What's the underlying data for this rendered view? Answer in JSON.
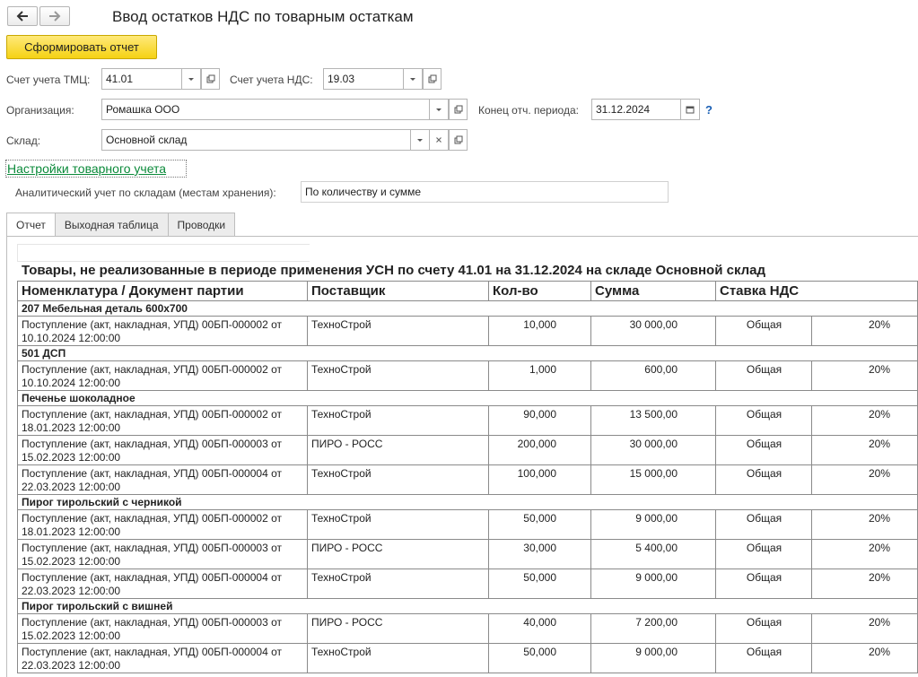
{
  "window": {
    "title": "Ввод остатков НДС по товарным остаткам"
  },
  "toolbar": {
    "generate_label": "Сформировать отчет"
  },
  "form": {
    "tmc_account_label": "Счет учета ТМЦ:",
    "tmc_account_value": "41.01",
    "vat_account_label": "Счет учета НДС:",
    "vat_account_value": "19.03",
    "org_label": "Организация:",
    "org_value": "Ромашка ООО",
    "period_end_label": "Конец отч. периода:",
    "period_end_value": "31.12.2024",
    "help_label": "?",
    "warehouse_label": "Склад:",
    "warehouse_value": "Основной склад",
    "settings_link": "Настройки товарного учета",
    "analytics_label": "Аналитический учет по складам (местам хранения):",
    "analytics_value": "По количеству и сумме"
  },
  "tabs": [
    {
      "label": "Отчет",
      "active": true
    },
    {
      "label": "Выходная таблица",
      "active": false
    },
    {
      "label": "Проводки",
      "active": false
    }
  ],
  "report": {
    "title": "Товары, не реализованные в периоде применения УСН по счету 41.01 на 31.12.2024  на складе Основной склад",
    "columns": [
      "Номенклатура / Документ партии",
      "Поставщик",
      "Кол-во",
      "Сумма",
      "Ставка НДС"
    ],
    "groups": [
      {
        "name": "207 Мебельная деталь 600x700",
        "rows": [
          {
            "doc": "Поступление (акт, накладная, УПД) 00БП-000002 от 10.10.2024 12:00:00",
            "supplier": "ТехноСтрой",
            "qty": "10,000",
            "sum": "30 000,00",
            "vat_type": "Общая",
            "rate": "20%"
          }
        ]
      },
      {
        "name": "501 ДСП",
        "rows": [
          {
            "doc": "Поступление (акт, накладная, УПД) 00БП-000002 от 10.10.2024 12:00:00",
            "supplier": "ТехноСтрой",
            "qty": "1,000",
            "sum": "600,00",
            "vat_type": "Общая",
            "rate": "20%"
          }
        ]
      },
      {
        "name": "Печенье шоколадное",
        "rows": [
          {
            "doc": "Поступление (акт, накладная, УПД) 00БП-000002 от 18.01.2023 12:00:00",
            "supplier": "ТехноСтрой",
            "qty": "90,000",
            "sum": "13 500,00",
            "vat_type": "Общая",
            "rate": "20%"
          },
          {
            "doc": "Поступление (акт, накладная, УПД) 00БП-000003 от 15.02.2023 12:00:00",
            "supplier": "ПИРО - РОСС",
            "qty": "200,000",
            "sum": "30 000,00",
            "vat_type": "Общая",
            "rate": "20%"
          },
          {
            "doc": "Поступление (акт, накладная, УПД) 00БП-000004 от 22.03.2023 12:00:00",
            "supplier": "ТехноСтрой",
            "qty": "100,000",
            "sum": "15 000,00",
            "vat_type": "Общая",
            "rate": "20%"
          }
        ]
      },
      {
        "name": "Пирог тирольский с черникой",
        "rows": [
          {
            "doc": "Поступление (акт, накладная, УПД) 00БП-000002 от 18.01.2023 12:00:00",
            "supplier": "ТехноСтрой",
            "qty": "50,000",
            "sum": "9 000,00",
            "vat_type": "Общая",
            "rate": "20%"
          },
          {
            "doc": "Поступление (акт, накладная, УПД) 00БП-000003 от 15.02.2023 12:00:00",
            "supplier": "ПИРО - РОСС",
            "qty": "30,000",
            "sum": "5 400,00",
            "vat_type": "Общая",
            "rate": "20%"
          },
          {
            "doc": "Поступление (акт, накладная, УПД) 00БП-000004 от 22.03.2023 12:00:00",
            "supplier": "ТехноСтрой",
            "qty": "50,000",
            "sum": "9 000,00",
            "vat_type": "Общая",
            "rate": "20%"
          }
        ]
      },
      {
        "name": "Пирог тирольский с вишней",
        "rows": [
          {
            "doc": "Поступление (акт, накладная, УПД) 00БП-000003 от 15.02.2023 12:00:00",
            "supplier": "ПИРО - РОСС",
            "qty": "40,000",
            "sum": "7 200,00",
            "vat_type": "Общая",
            "rate": "20%"
          },
          {
            "doc": "Поступление (акт, накладная, УПД) 00БП-000004 от 22.03.2023 12:00:00",
            "supplier": "ТехноСтрой",
            "qty": "50,000",
            "sum": "9 000,00",
            "vat_type": "Общая",
            "rate": "20%"
          }
        ]
      }
    ]
  }
}
